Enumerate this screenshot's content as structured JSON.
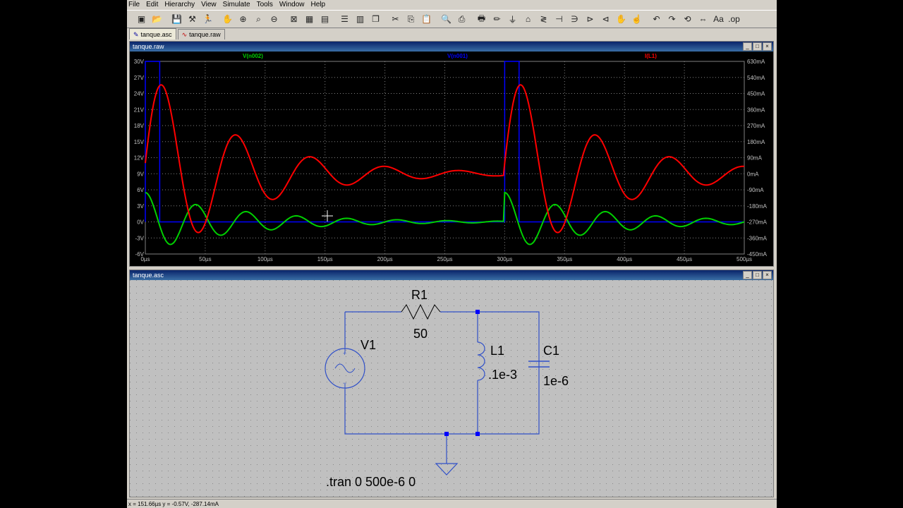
{
  "menu": [
    "File",
    "Edit",
    "Hierarchy",
    "View",
    "Simulate",
    "Tools",
    "Window",
    "Help"
  ],
  "toolbar_icons": [
    "new-schematic-icon",
    "open-icon",
    "save-icon",
    "control-panel-icon",
    "run-icon",
    "halt-icon",
    "zoom-in-icon",
    "zoom-rect-icon",
    "zoom-out-icon",
    "zoom-fit-icon",
    "autoscale-icon",
    "view-icon",
    "tile-horizontal-icon",
    "tile-vertical-icon",
    "cascade-icon",
    "cut-icon",
    "copy-icon",
    "paste-icon",
    "find-icon",
    "print-setup-icon",
    "print-icon",
    "draw-wire-icon",
    "ground-icon",
    "label-net-icon",
    "resistor-icon",
    "capacitor-icon",
    "inductor-icon",
    "diode-icon",
    "component-icon",
    "move-icon",
    "drag-icon",
    "undo-icon",
    "redo-icon",
    "rotate-icon",
    "mirror-icon",
    "text-icon",
    "spice-directive-icon"
  ],
  "tabs": [
    {
      "label": "tanque.asc",
      "icon": "schematic-icon"
    },
    {
      "label": "tanque.raw",
      "icon": "waveform-icon"
    }
  ],
  "plot_window": {
    "title": "tanque.raw"
  },
  "schematic_window": {
    "title": "tanque.asc"
  },
  "status_text": "x = 151.66µs   y = -0.57V, -287.14mA",
  "chart_data": {
    "type": "line",
    "series": [
      {
        "name": "V(n002)",
        "color": "#00d000",
        "axis": "left"
      },
      {
        "name": "V(n001)",
        "color": "#0000ff",
        "axis": "left"
      },
      {
        "name": "I(L1)",
        "color": "#ff0000",
        "axis": "right"
      }
    ],
    "x_ticks": [
      "0µs",
      "50µs",
      "100µs",
      "150µs",
      "200µs",
      "250µs",
      "300µs",
      "350µs",
      "400µs",
      "450µs",
      "500µs"
    ],
    "y_left_ticks": [
      "30V",
      "27V",
      "24V",
      "21V",
      "18V",
      "15V",
      "12V",
      "9V",
      "6V",
      "3V",
      "0V",
      "-3V",
      "-6V"
    ],
    "y_right_ticks": [
      "630mA",
      "540mA",
      "450mA",
      "360mA",
      "270mA",
      "180mA",
      "90mA",
      "0mA",
      "-90mA",
      "-180mA",
      "-270mA",
      "-360mA",
      "-450mA"
    ],
    "xlim": [
      0,
      500
    ],
    "ylim_left": [
      -6,
      30
    ],
    "ylim_right": [
      -450,
      630
    ],
    "grid": true,
    "pulse": {
      "v_high": 30,
      "v_low": 0,
      "on_intervals": [
        [
          0,
          12
        ],
        [
          300,
          312
        ]
      ]
    },
    "v_n002": {
      "peak_first": 5,
      "decay_tau_us": 80,
      "period_us": 42
    },
    "i_l1": {
      "offset_ma": 0,
      "amp_ma": 600,
      "decay_tau_us": 75,
      "period_us": 62
    }
  },
  "schematic": {
    "R1": {
      "name": "R1",
      "value": "50"
    },
    "V1": {
      "name": "V1"
    },
    "L1": {
      "name": "L1",
      "value": ".1e-3"
    },
    "C1": {
      "name": "C1",
      "value": "1e-6"
    },
    "directive": ".tran 0 500e-6 0"
  }
}
